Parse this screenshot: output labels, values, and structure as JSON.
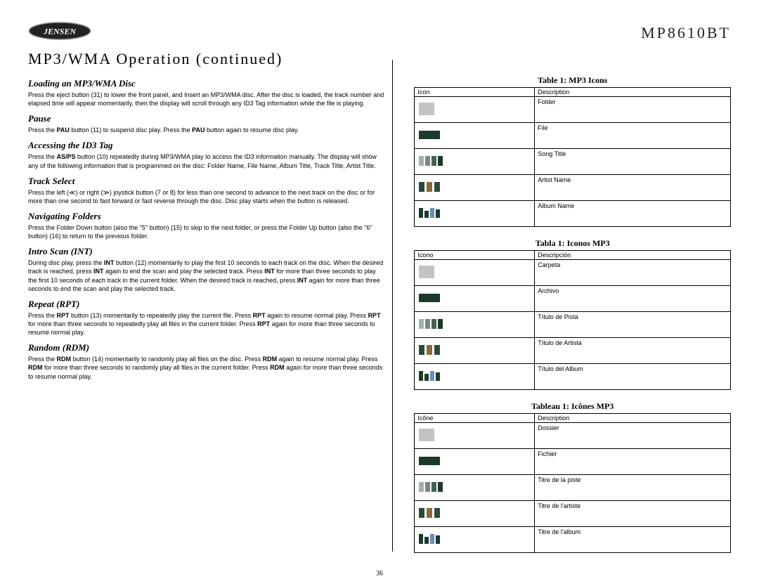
{
  "header": {
    "model": "MP8610BT",
    "logo_text": "JENSEN"
  },
  "main_title": "MP3/WMA Operation (continued)",
  "page_number": "36",
  "left": {
    "s1_title": "Loading an MP3/WMA Disc",
    "s1_text": "Press the eject button (31) to lower the front panel, and Insert an MP3/WMA disc. After the disc is loaded, the track number and elapsed time will appear momentarily, then the display will scroll through any ID3 Tag information while the file is playing.",
    "s2_title": "Pause",
    "s2_pre": "Press the ",
    "s2_b1": "PAU",
    "s2_mid": " button (11) to suspend disc play. Press the ",
    "s2_b2": "PAU",
    "s2_post": " button again to resume disc play.",
    "s3_title": "Accessing the ID3 Tag",
    "s3_pre": "Press the ",
    "s3_b1": "AS/PS",
    "s3_post": " button (10) repeatedly during MP3/WMA play to access the ID3 information manually. The display will show any of the following information that is programmed on the disc: Folder Name, File Name, Album Title, Track Title, Artist Title.",
    "s4_title": "Track Select",
    "s4_text": "Press the left (≪) or right (≫) joystick button (7 or 8) for less than one second to advance to the next track on the disc or for more than one second to fast forward or fast reverse through the disc. Disc play starts when the button is released.",
    "s5_title": "Navigating Folders",
    "s5_text": "Press the Folder Down button (also the \"5\" button) (15) to skip to the next folder, or press the Folder Up button (also the \"6\" button) (16) to return to the previous folder.",
    "s6_title": "Intro Scan (INT)",
    "s6_a": "During disc play, press the ",
    "s6_b1": "INT",
    "s6_b": " button (12) momentarily to play the first 10 seconds to each track on the disc. When the desired track is reached, press ",
    "s6_b2": "INT",
    "s6_c": " again to end the scan and play the selected track. Press ",
    "s6_b3": "INT",
    "s6_d": " for more than three seconds to play the first 10 seconds of each track in the current folder. When the desired track is reached, press ",
    "s6_b4": "INT",
    "s6_e": " again for more than three seconds to end the scan and play the selected track.",
    "s7_title": "Repeat (RPT)",
    "s7_a": "Press the ",
    "s7_b1": "RPT",
    "s7_b": " button (13) momentarily to repeatedly play the current file. Press ",
    "s7_b2": "RPT",
    "s7_c": " again to resume normal play. Press ",
    "s7_b3": "RPT",
    "s7_d": " for more than three seconds to repeatedly play all files in the current folder. Press ",
    "s7_b4": "RPT",
    "s7_e": " again for more than three seconds to resume normal play.",
    "s8_title": "Random (RDM)",
    "s8_a": "Press the ",
    "s8_b1": "RDM",
    "s8_b": " button (14) momentarily to randomly play all files on the disc. Press ",
    "s8_b2": "RDM",
    "s8_c": " again to resume normal play. Press ",
    "s8_b3": "RDM",
    "s8_d": " for more than three seconds to randomly play all files in the current folder. Press ",
    "s8_b4": "RDM",
    "s8_e": " again for more than three seconds to resume normal play."
  },
  "right": {
    "t1_title": "Table 1: MP3 Icons",
    "t1_h1": "Icon",
    "t1_h2": "Description",
    "t1_r1": "Folder",
    "t1_r2": "File",
    "t1_r3": "Song Title",
    "t1_r4": "Artist Name",
    "t1_r5": "Album Name",
    "t2_title": "Tabla 1:  Iconos MP3",
    "t2_h1": "Icono",
    "t2_h2": "Descripción",
    "t2_r1": "Carpeta",
    "t2_r2": "Archivo",
    "t2_r3": "Título de Pista",
    "t2_r4": "Título de Artista",
    "t2_r5": "Título del Album",
    "t3_title": "Tableau 1: Icônes MP3",
    "t3_h1": "Icône",
    "t3_h2": "Description",
    "t3_r1": "Dossier",
    "t3_r2": "Fichier",
    "t3_r3": "Titre de la piste",
    "t3_r4": "Titre de l'artiste",
    "t3_r5": "Titre de l'album"
  }
}
